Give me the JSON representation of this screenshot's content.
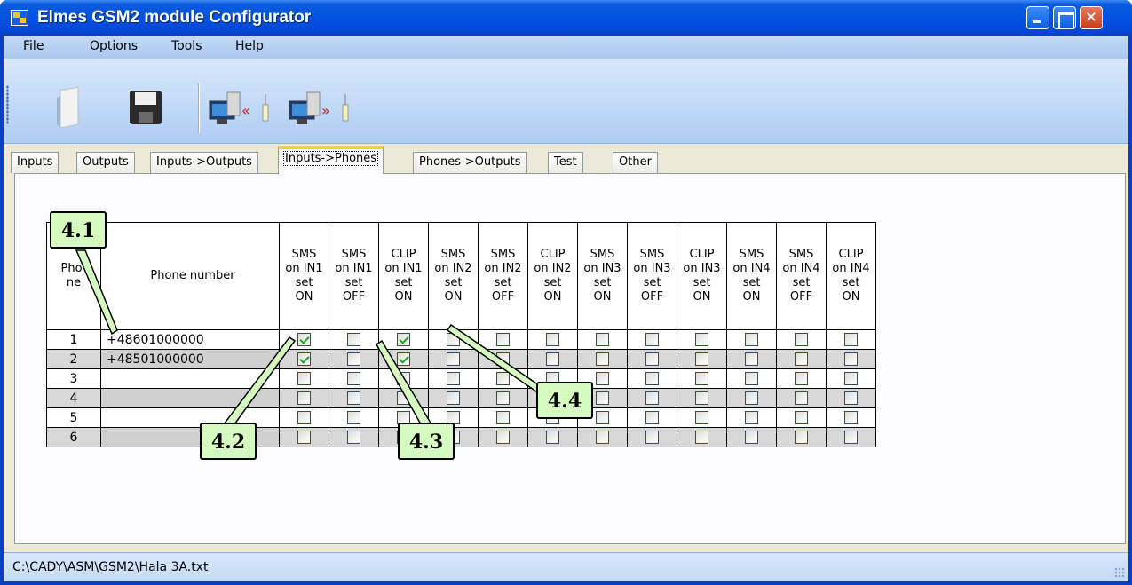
{
  "window": {
    "title": "Elmes GSM2 module Configurator"
  },
  "menu": [
    "File",
    "Options",
    "Tools",
    "Help"
  ],
  "toolbar": {
    "icons": [
      "open-file-icon",
      "save-floppy-icon",
      "read-from-module-icon",
      "write-to-module-icon"
    ]
  },
  "tabs": [
    "Inputs",
    "Outputs",
    "Inputs->Outputs",
    "Inputs->Phones",
    "Phones->Outputs",
    "Test",
    "Other"
  ],
  "active_tab": "Inputs->Phones",
  "table": {
    "col_num_header": "Pho-\nne",
    "col_phone_header": "Phone number",
    "check_headers": [
      "SMS\non IN1\nset\nON",
      "SMS\non IN1\nset\nOFF",
      "CLIP\non IN1\nset\nON",
      "SMS\non IN2\nset\nON",
      "SMS\non IN2\nset\nOFF",
      "CLIP\non IN2\nset\nON",
      "SMS\non IN3\nset\nON",
      "SMS\non IN3\nset\nOFF",
      "CLIP\non IN3\nset\nON",
      "SMS\non IN4\nset\nON",
      "SMS\non IN4\nset\nOFF",
      "CLIP\non IN4\nset\nON"
    ],
    "rows": [
      {
        "num": "1",
        "phone": "+48601000000",
        "checks": [
          true,
          false,
          true,
          false,
          false,
          false,
          false,
          false,
          false,
          false,
          false,
          false
        ]
      },
      {
        "num": "2",
        "phone": "+48501000000",
        "checks": [
          true,
          false,
          true,
          false,
          false,
          false,
          false,
          false,
          false,
          false,
          false,
          false
        ]
      },
      {
        "num": "3",
        "phone": "",
        "checks": [
          false,
          false,
          false,
          false,
          false,
          false,
          false,
          false,
          false,
          false,
          false,
          false
        ]
      },
      {
        "num": "4",
        "phone": "",
        "checks": [
          false,
          false,
          false,
          false,
          false,
          false,
          false,
          false,
          false,
          false,
          false,
          false
        ]
      },
      {
        "num": "5",
        "phone": "",
        "checks": [
          false,
          false,
          false,
          false,
          false,
          false,
          false,
          false,
          false,
          false,
          false,
          false
        ]
      },
      {
        "num": "6",
        "phone": "",
        "checks": [
          false,
          false,
          false,
          false,
          false,
          false,
          false,
          false,
          false,
          false,
          false,
          false
        ]
      }
    ]
  },
  "callouts": [
    "4.1",
    "4.2",
    "4.3",
    "4.4"
  ],
  "statusbar": {
    "path": "C:\\CADY\\ASM\\GSM2\\Hala 3A.txt"
  },
  "colors": {
    "titlebar": "#0353e0",
    "callout_bg": "#d6fbc0",
    "check_mark": "#21a121",
    "alt_row": "#d8d8d8"
  }
}
